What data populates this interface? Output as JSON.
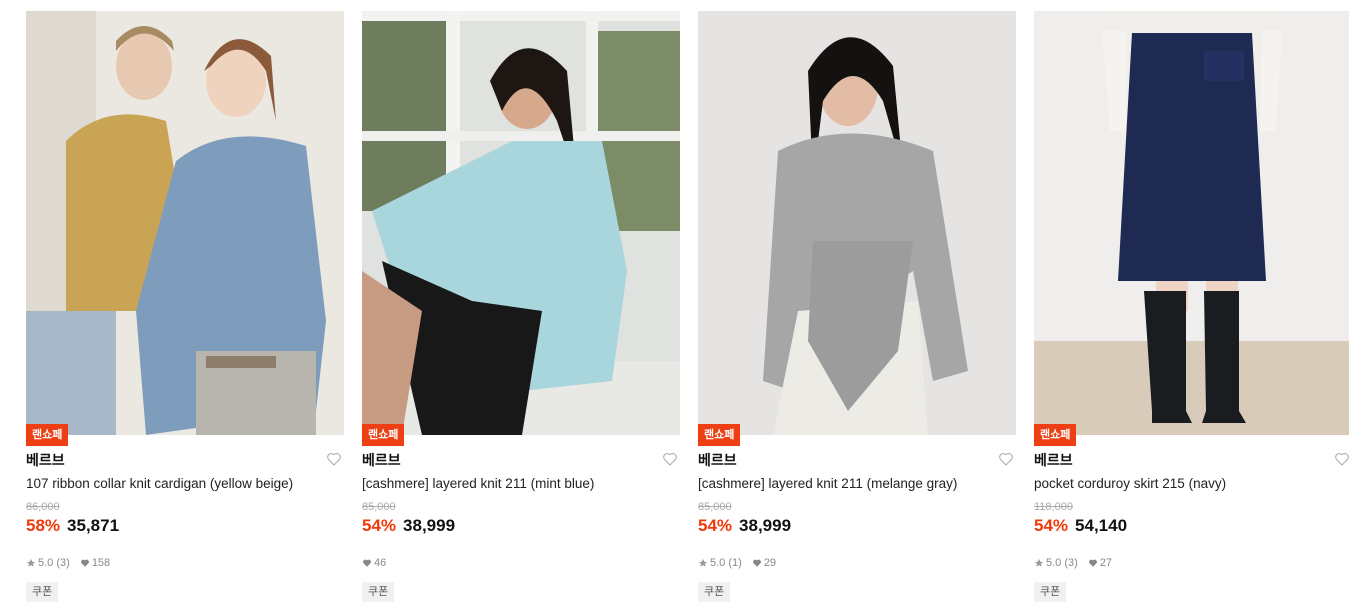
{
  "products": [
    {
      "badge": "랜쇼페",
      "brand": "베르브",
      "name": "107 ribbon collar knit cardigan (yellow beige)",
      "original_price": "86,000",
      "discount": "58%",
      "price": "35,871",
      "rating": "5.0",
      "review_count": "(3)",
      "likes": "158",
      "coupon": "쿠폰",
      "photo_bg": "#e9e5de"
    },
    {
      "badge": "랜쇼페",
      "brand": "베르브",
      "name": "[cashmere] layered knit 211 (mint blue)",
      "original_price": "85,000",
      "discount": "54%",
      "price": "38,999",
      "rating": "",
      "review_count": "",
      "likes": "46",
      "coupon": "쿠폰",
      "photo_bg": "#d9dcd8"
    },
    {
      "badge": "랜쇼페",
      "brand": "베르브",
      "name": "[cashmere] layered knit 211 (melange gray)",
      "original_price": "85,000",
      "discount": "54%",
      "price": "38,999",
      "rating": "5.0",
      "review_count": "(1)",
      "likes": "29",
      "coupon": "쿠폰",
      "photo_bg": "#e4e3e1"
    },
    {
      "badge": "랜쇼페",
      "brand": "베르브",
      "name": "pocket corduroy skirt 215 (navy)",
      "original_price": "118,000",
      "discount": "54%",
      "price": "54,140",
      "rating": "5.0",
      "review_count": "(3)",
      "likes": "27",
      "coupon": "쿠폰",
      "photo_bg": "#ecebe8"
    }
  ],
  "colors": {
    "badge": "#ee3f14",
    "discount": "#f0380b"
  }
}
